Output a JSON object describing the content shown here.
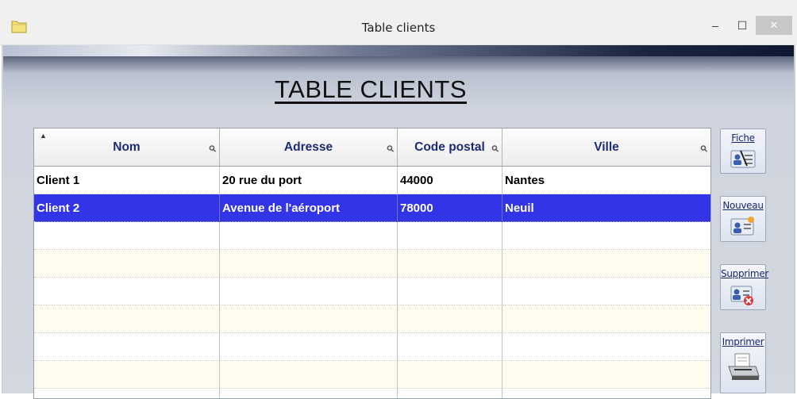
{
  "window": {
    "title": "Table  clients",
    "minimize": "–",
    "maximize": "☐",
    "close": "✕"
  },
  "page": {
    "heading": "TABLE  CLIENTS"
  },
  "table": {
    "columns": [
      "Nom",
      "Adresse",
      "Code postal",
      "Ville"
    ],
    "sort_indicator": "▲",
    "search_glyph": "⚲",
    "rows": [
      {
        "nom": "Client 1",
        "adresse": "20 rue du port",
        "code_postal": "44000",
        "ville": "Nantes",
        "selected": false
      },
      {
        "nom": "Client 2",
        "adresse": "Avenue de l'aéroport",
        "code_postal": "78000",
        "ville": "Neuil",
        "selected": true
      }
    ]
  },
  "actions": {
    "fiche": "Fiche",
    "nouveau": "Nouveau",
    "supprimer": "Supprimer",
    "imprimer": "Imprimer"
  },
  "colors": {
    "selection": "#3333e8",
    "header_text": "#1c2a78",
    "alt_row": "#fefdf0"
  }
}
